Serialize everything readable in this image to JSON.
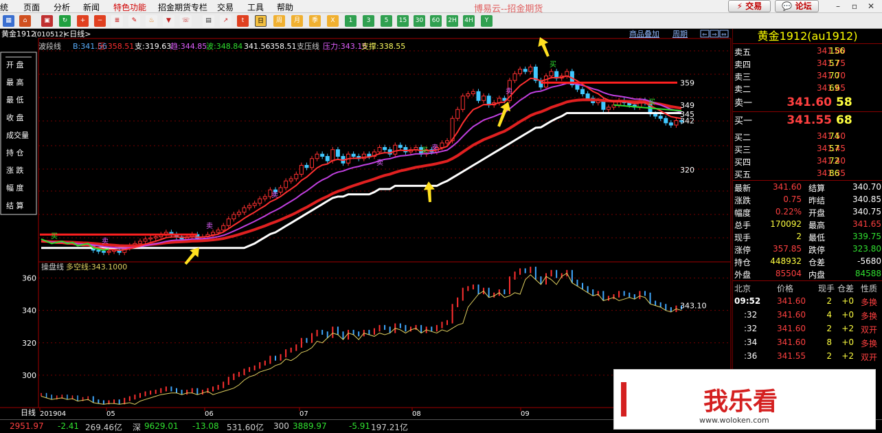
{
  "menu": {
    "items": [
      "统",
      "页面",
      "分析",
      "新闻",
      "特色功能",
      "招金期货专栏",
      "交易",
      "工具",
      "帮助"
    ],
    "highlight": [
      "特色功能"
    ]
  },
  "app_title": "博易云--招金期货",
  "top_buttons": {
    "trade": "交易",
    "forum": "论坛"
  },
  "toolbar": {
    "period_buttons": [
      "周",
      "月",
      "季",
      "X",
      "1",
      "3",
      "5",
      "15",
      "30",
      "60",
      "2H",
      "4H",
      "Y"
    ]
  },
  "chart_header": {
    "instrument": "黄金1912",
    "code": "(010512)",
    "period": "<日线>",
    "overlay_link": "商品叠加",
    "period_link": "周期"
  },
  "left_panel": {
    "labels": [
      "开 盘",
      "最 高",
      "最 低",
      "收 盘",
      "成交量",
      "持 仓",
      "涨 跌",
      "幅 度",
      "结 算"
    ]
  },
  "main_legend": {
    "items": [
      {
        "text": "波段线",
        "color": "#d0d0d0"
      },
      {
        "text": "B:341.56",
        "color": "#5ab0ff"
      },
      {
        "text": "压:358.51",
        "color": "#ff3030"
      },
      {
        "text": "支:319.63",
        "color": "#ffffff"
      },
      {
        "text": "趋:344.85",
        "color": "#e060ff"
      },
      {
        "text": "波:348.84",
        "color": "#30e030"
      },
      {
        "text": "341.56",
        "color": "#ffffff"
      },
      {
        "text": "358.51",
        "color": "#ffffff"
      },
      {
        "text": "支压线",
        "color": "#d0d0d0"
      },
      {
        "text": "压力:343.15",
        "color": "#e060ff"
      },
      {
        "text": "支撑:338.55",
        "color": "#ffff60"
      }
    ]
  },
  "sub_legend": {
    "name": "操盘线",
    "value": "多空线:343.1000"
  },
  "signals": {
    "buy": "买",
    "sell": "卖"
  },
  "chart_data": {
    "type": "candlestick",
    "period": "日线",
    "x_tick_labels": [
      "201904",
      "05",
      "06",
      "07",
      "08",
      "09"
    ],
    "y_ticks_sub": [
      300,
      320,
      340,
      360
    ],
    "price_tags_main": [
      359,
      349,
      345,
      342,
      320
    ],
    "sub_last_value_label": "343.10",
    "series": [
      {
        "name": "压",
        "color": "#ff2020",
        "last": 358.51
      },
      {
        "name": "支",
        "color": "#ffffff",
        "last": 319.63
      },
      {
        "name": "趋",
        "color": "#e060ff",
        "last": 344.85
      },
      {
        "name": "波",
        "color": "#30e030",
        "last": 348.84
      },
      {
        "name": "多空线",
        "color": "#e0d060",
        "last": 343.1
      }
    ],
    "closes": [
      288,
      287,
      286,
      286.5,
      287,
      286,
      286.5,
      285,
      285.5,
      286,
      284,
      283.5,
      283,
      283.5,
      284,
      283,
      285,
      286,
      287,
      288,
      289,
      289.5,
      290,
      291,
      292,
      291,
      290,
      289,
      290,
      291,
      289,
      290,
      291,
      292,
      293,
      295,
      298,
      300,
      301,
      303,
      304,
      305,
      307,
      308,
      311,
      310,
      312,
      315,
      316,
      318,
      322,
      321,
      325,
      327,
      326,
      324,
      329,
      326,
      323,
      327,
      326,
      325,
      327,
      326,
      328,
      330,
      329,
      327,
      331,
      330,
      328,
      329,
      330,
      327,
      329,
      328,
      330,
      332,
      333,
      343,
      347,
      353,
      354,
      355,
      351,
      353,
      349,
      350,
      352,
      351,
      360,
      363,
      365,
      364,
      366,
      360,
      357,
      362,
      364,
      361,
      362,
      364,
      358,
      356,
      354,
      352,
      350,
      351,
      347,
      348,
      349,
      351,
      350,
      349,
      348,
      351,
      350,
      345,
      344,
      343,
      341,
      340,
      342,
      341.6
    ],
    "candles_from_index": 10
  },
  "quote_panel": {
    "title": "黄金1912(au1912)",
    "asks": [
      {
        "label": "卖五",
        "price": "341.80",
        "vol": "156"
      },
      {
        "label": "卖四",
        "price": "341.75",
        "vol": "57"
      },
      {
        "label": "卖三",
        "price": "341.70",
        "vol": "70"
      },
      {
        "label": "卖二",
        "price": "341.65",
        "vol": "69"
      },
      {
        "label": "卖一",
        "price": "341.60",
        "vol": "58"
      }
    ],
    "bids": [
      {
        "label": "买一",
        "price": "341.55",
        "vol": "68"
      },
      {
        "label": "买二",
        "price": "341.50",
        "vol": "74"
      },
      {
        "label": "买三",
        "price": "341.45",
        "vol": "57"
      },
      {
        "label": "买四",
        "price": "341.40",
        "vol": "72"
      },
      {
        "label": "买五",
        "price": "341.35",
        "vol": "86"
      }
    ],
    "stats": [
      {
        "l1": "最新",
        "v1": "341.60",
        "c1": "#ff4040",
        "l2": "结算",
        "v2": "340.70",
        "c2": "#ffffff"
      },
      {
        "l1": "涨跌",
        "v1": "0.75",
        "c1": "#ff4040",
        "l2": "昨结",
        "v2": "340.85",
        "c2": "#ffffff"
      },
      {
        "l1": "幅度",
        "v1": "0.22%",
        "c1": "#ff4040",
        "l2": "开盘",
        "v2": "340.75",
        "c2": "#ffffff"
      },
      {
        "l1": "总手",
        "v1": "170092",
        "c1": "#ffff40",
        "l2": "最高",
        "v2": "341.65",
        "c2": "#ff4040"
      },
      {
        "l1": "现手",
        "v1": "2",
        "c1": "#ffff40",
        "l2": "最低",
        "v2": "339.75",
        "c2": "#30e030"
      },
      {
        "l1": "涨停",
        "v1": "357.85",
        "c1": "#ff4040",
        "l2": "跌停",
        "v2": "323.80",
        "c2": "#30e030"
      },
      {
        "l1": "持仓",
        "v1": "448932",
        "c1": "#ffff40",
        "l2": "仓差",
        "v2": "-5680",
        "c2": "#ffffff"
      },
      {
        "l1": "外盘",
        "v1": "85504",
        "c1": "#ff4040",
        "l2": "内盘",
        "v2": "84588",
        "c2": "#30e030"
      }
    ],
    "ticks_header": [
      "北京",
      "价格",
      "现手",
      "仓差",
      "性质"
    ],
    "ticks": [
      {
        "time": "09:52",
        "price": "341.60",
        "vol": "2",
        "diff": "+0",
        "type": "多换"
      },
      {
        "time": ":32",
        "price": "341.60",
        "vol": "4",
        "diff": "+0",
        "type": "多换"
      },
      {
        "time": ":32",
        "price": "341.60",
        "vol": "2",
        "diff": "+2",
        "type": "双开"
      },
      {
        "time": ":34",
        "price": "341.60",
        "vol": "8",
        "diff": "+0",
        "type": "多换"
      },
      {
        "time": ":36",
        "price": "341.55",
        "vol": "2",
        "diff": "+2",
        "type": "双开"
      }
    ]
  },
  "status_bar": {
    "items": [
      {
        "text": "2951.97",
        "color": "#ff4040"
      },
      {
        "text": "-2.41",
        "color": "#30e030"
      },
      {
        "text": "269.46亿",
        "color": "#d0d0d0"
      },
      {
        "text": "深",
        "color": "#d0d0d0"
      },
      {
        "text": "9629.01",
        "color": "#30e030"
      },
      {
        "text": "-13.08",
        "color": "#30e030"
      },
      {
        "text": "531.60亿",
        "color": "#d0d0d0"
      },
      {
        "text": "300",
        "color": "#d0d0d0"
      },
      {
        "text": "3889.97",
        "color": "#30e030"
      },
      {
        "text": "-5.91",
        "color": "#30e030"
      },
      {
        "text": "197.21亿",
        "color": "#d0d0d0"
      }
    ]
  },
  "watermark": {
    "brand": "我乐看",
    "url": "www.woloken.com"
  }
}
